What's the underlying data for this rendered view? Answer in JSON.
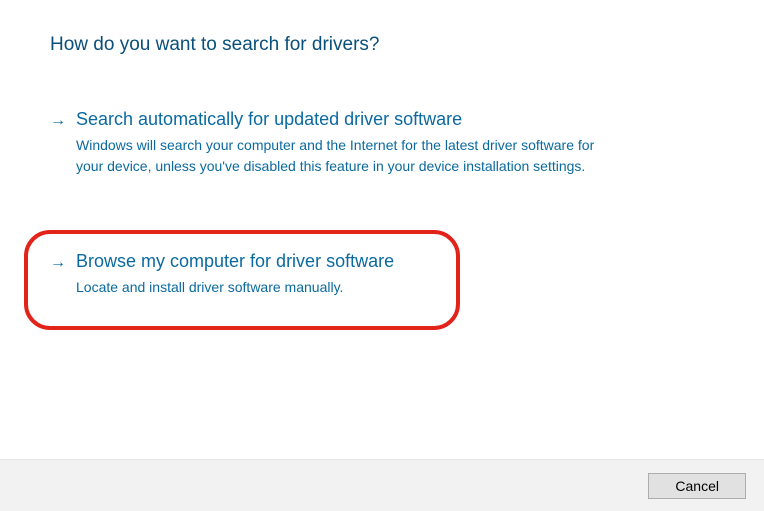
{
  "title": "How do you want to search for drivers?",
  "options": [
    {
      "title": "Search automatically for updated driver software",
      "desc": "Windows will search your computer and the Internet for the latest driver software for your device, unless you've disabled this feature in your device installation settings."
    },
    {
      "title": "Browse my computer for driver software",
      "desc": "Locate and install driver software manually."
    }
  ],
  "footer": {
    "cancel_label": "Cancel"
  }
}
